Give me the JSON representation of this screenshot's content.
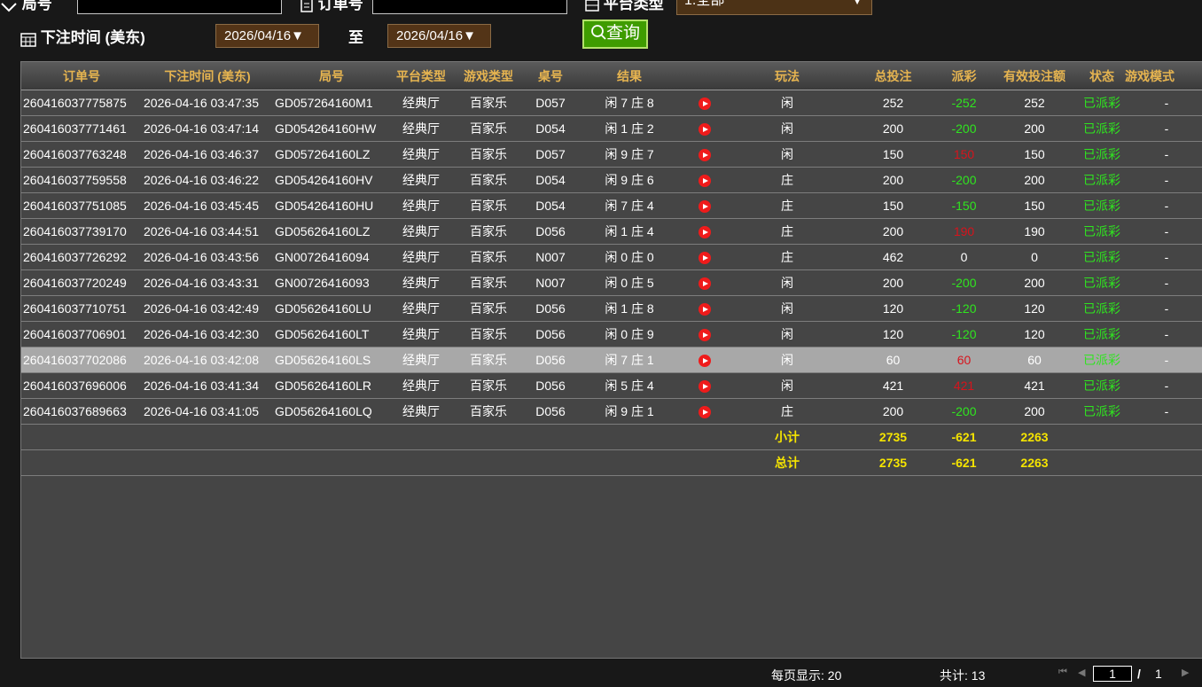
{
  "filters": {
    "game_no_label": "局号",
    "order_no_label": "订单号",
    "platform_label": "平台类型",
    "platform_value": "1.全部",
    "bet_time_label": "下注时间 (美东)",
    "date_from": "2026/04/16▼",
    "to_label": "至",
    "date_to": "2026/04/16▼",
    "search_button": "查询"
  },
  "table": {
    "headers": [
      "订单号",
      "下注时间 (美东)",
      "局号",
      "平台类型",
      "游戏类型",
      "桌号",
      "结果",
      "",
      "玩法",
      "总投注",
      "派彩",
      "有效投注额",
      "状态",
      "游戏模式"
    ],
    "rows": [
      {
        "order": "260416037775875",
        "time": "2026-04-16 03:47:35",
        "game": "GD057264160M1",
        "platform": "经典厅",
        "type": "百家乐",
        "table": "D057",
        "result": "闲 7 庄 8",
        "play": "闲",
        "bet": "252",
        "payout": "-252",
        "payout_class": "neg",
        "valid": "252",
        "status": "已派彩",
        "mode": "-"
      },
      {
        "order": "260416037771461",
        "time": "2026-04-16 03:47:14",
        "game": "GD054264160HW",
        "platform": "经典厅",
        "type": "百家乐",
        "table": "D054",
        "result": "闲 1 庄 2",
        "play": "闲",
        "bet": "200",
        "payout": "-200",
        "payout_class": "neg",
        "valid": "200",
        "status": "已派彩",
        "mode": "-"
      },
      {
        "order": "260416037763248",
        "time": "2026-04-16 03:46:37",
        "game": "GD057264160LZ",
        "platform": "经典厅",
        "type": "百家乐",
        "table": "D057",
        "result": "闲 9 庄 7",
        "play": "闲",
        "bet": "150",
        "payout": "150",
        "payout_class": "pos",
        "valid": "150",
        "status": "已派彩",
        "mode": "-"
      },
      {
        "order": "260416037759558",
        "time": "2026-04-16 03:46:22",
        "game": "GD054264160HV",
        "platform": "经典厅",
        "type": "百家乐",
        "table": "D054",
        "result": "闲 9 庄 6",
        "play": "庄",
        "bet": "200",
        "payout": "-200",
        "payout_class": "neg",
        "valid": "200",
        "status": "已派彩",
        "mode": "-"
      },
      {
        "order": "260416037751085",
        "time": "2026-04-16 03:45:45",
        "game": "GD054264160HU",
        "platform": "经典厅",
        "type": "百家乐",
        "table": "D054",
        "result": "闲 7 庄 4",
        "play": "庄",
        "bet": "150",
        "payout": "-150",
        "payout_class": "neg",
        "valid": "150",
        "status": "已派彩",
        "mode": "-"
      },
      {
        "order": "260416037739170",
        "time": "2026-04-16 03:44:51",
        "game": "GD056264160LZ",
        "platform": "经典厅",
        "type": "百家乐",
        "table": "D056",
        "result": "闲 1 庄 4",
        "play": "庄",
        "bet": "200",
        "payout": "190",
        "payout_class": "pos",
        "valid": "190",
        "status": "已派彩",
        "mode": "-"
      },
      {
        "order": "260416037726292",
        "time": "2026-04-16 03:43:56",
        "game": "GN00726416094",
        "platform": "经典厅",
        "type": "百家乐",
        "table": "N007",
        "result": "闲 0 庄 0",
        "play": "庄",
        "bet": "462",
        "payout": "0",
        "payout_class": "zero",
        "valid": "0",
        "status": "已派彩",
        "mode": "-"
      },
      {
        "order": "260416037720249",
        "time": "2026-04-16 03:43:31",
        "game": "GN00726416093",
        "platform": "经典厅",
        "type": "百家乐",
        "table": "N007",
        "result": "闲 0 庄 5",
        "play": "闲",
        "bet": "200",
        "payout": "-200",
        "payout_class": "neg",
        "valid": "200",
        "status": "已派彩",
        "mode": "-"
      },
      {
        "order": "260416037710751",
        "time": "2026-04-16 03:42:49",
        "game": "GD056264160LU",
        "platform": "经典厅",
        "type": "百家乐",
        "table": "D056",
        "result": "闲 1 庄 8",
        "play": "闲",
        "bet": "120",
        "payout": "-120",
        "payout_class": "neg",
        "valid": "120",
        "status": "已派彩",
        "mode": "-"
      },
      {
        "order": "260416037706901",
        "time": "2026-04-16 03:42:30",
        "game": "GD056264160LT",
        "platform": "经典厅",
        "type": "百家乐",
        "table": "D056",
        "result": "闲 0 庄 9",
        "play": "闲",
        "bet": "120",
        "payout": "-120",
        "payout_class": "neg",
        "valid": "120",
        "status": "已派彩",
        "mode": "-"
      },
      {
        "order": "260416037702086",
        "time": "2026-04-16 03:42:08",
        "game": "GD056264160LS",
        "platform": "经典厅",
        "type": "百家乐",
        "table": "D056",
        "result": "闲 7 庄 1",
        "play": "闲",
        "bet": "60",
        "payout": "60",
        "payout_class": "pos",
        "valid": "60",
        "status": "已派彩",
        "mode": "-",
        "highlight": true
      },
      {
        "order": "260416037696006",
        "time": "2026-04-16 03:41:34",
        "game": "GD056264160LR",
        "platform": "经典厅",
        "type": "百家乐",
        "table": "D056",
        "result": "闲 5 庄 4",
        "play": "闲",
        "bet": "421",
        "payout": "421",
        "payout_class": "pos",
        "valid": "421",
        "status": "已派彩",
        "mode": "-"
      },
      {
        "order": "260416037689663",
        "time": "2026-04-16 03:41:05",
        "game": "GD056264160LQ",
        "platform": "经典厅",
        "type": "百家乐",
        "table": "D056",
        "result": "闲 9 庄 1",
        "play": "庄",
        "bet": "200",
        "payout": "-200",
        "payout_class": "neg",
        "valid": "200",
        "status": "已派彩",
        "mode": "-"
      }
    ],
    "subtotal": {
      "label": "小计",
      "bet": "2735",
      "payout": "-621",
      "valid": "2263"
    },
    "total": {
      "label": "总计",
      "bet": "2735",
      "payout": "-621",
      "valid": "2263"
    }
  },
  "footer": {
    "per_page": "每页显示: 20",
    "total_count": "共计: 13",
    "first_icon": "⏮",
    "prev_icon": "◀",
    "page": "1",
    "separator": "/",
    "pages": "1",
    "next_icon": "▶"
  },
  "colors": {
    "accent": "#e6b450",
    "negative": "#2fe51f",
    "positive": "#d7131c",
    "subtotal": "#f5e400"
  }
}
